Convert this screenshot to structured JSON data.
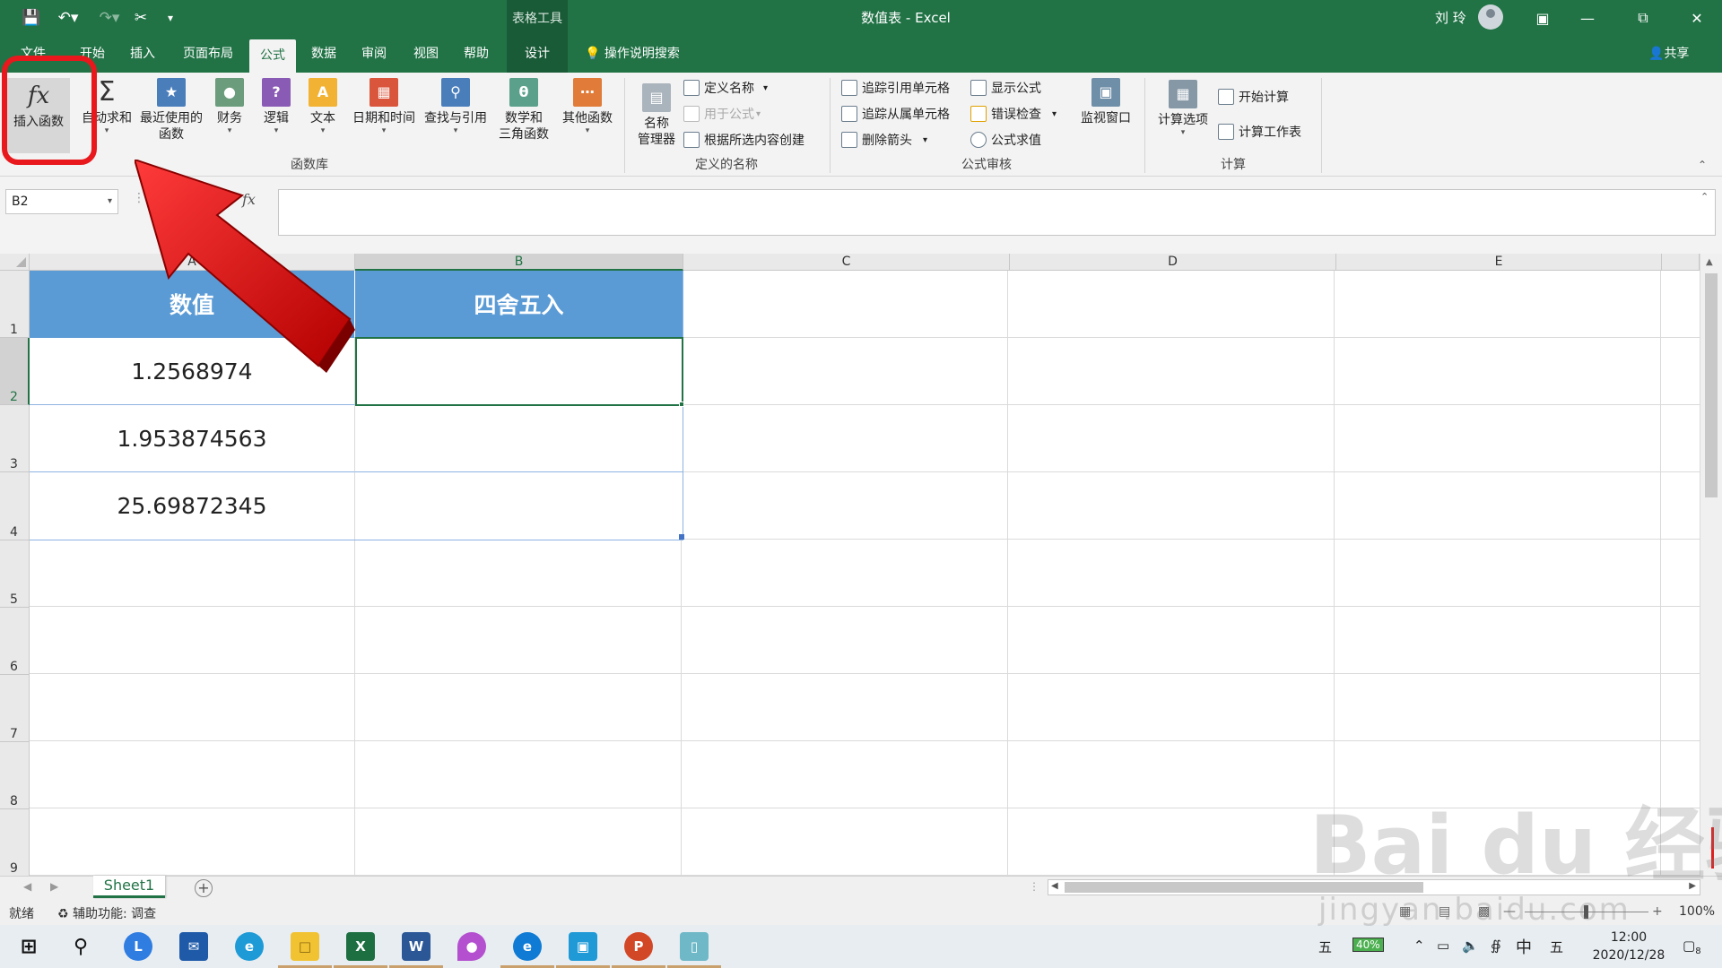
{
  "titlebar": {
    "context_label": "表格工具",
    "title": "数值表 - Excel",
    "user": "刘 玲"
  },
  "tabs": [
    {
      "label": "文件"
    },
    {
      "label": "开始"
    },
    {
      "label": "插入"
    },
    {
      "label": "页面布局"
    },
    {
      "label": "公式"
    },
    {
      "label": "数据"
    },
    {
      "label": "审阅"
    },
    {
      "label": "视图"
    },
    {
      "label": "帮助"
    },
    {
      "label": "设计"
    }
  ],
  "tell_me": "操作说明搜索",
  "share": "共享",
  "ribbon": {
    "function_library": {
      "insert_function": "插入函数",
      "autosum": "自动求和",
      "recent_1": "最近使用的",
      "recent_2": "函数",
      "financial": "财务",
      "logical": "逻辑",
      "text": "文本",
      "datetime": "日期和时间",
      "lookup": "查找与引用",
      "math_1": "数学和",
      "math_2": "三角函数",
      "more": "其他函数",
      "group": "函数库"
    },
    "defined_names": {
      "manager_1": "名称",
      "manager_2": "管理器",
      "define": "定义名称",
      "use_in": "用于公式",
      "create": "根据所选内容创建",
      "group": "定义的名称"
    },
    "auditing": {
      "trace_prec": "追踪引用单元格",
      "trace_dep": "追踪从属单元格",
      "remove_arrows": "删除箭头",
      "show_formulas": "显示公式",
      "error_check": "错误检查",
      "evaluate": "公式求值",
      "watch": "监视窗口",
      "group": "公式审核"
    },
    "calculation": {
      "options": "计算选项",
      "calc_now": "开始计算",
      "calc_sheet": "计算工作表",
      "group": "计算"
    }
  },
  "namebox": "B2",
  "fx_label": "fx",
  "columns": [
    "A",
    "B",
    "C",
    "D",
    "E"
  ],
  "rows": [
    "1",
    "2",
    "3",
    "4",
    "5",
    "6",
    "7",
    "8",
    "9"
  ],
  "table": {
    "header_a": "数值",
    "header_b": "四舍五入",
    "values": [
      "1.2568974",
      "1.953874563",
      "25.69872345"
    ]
  },
  "sheet_tab": "Sheet1",
  "status": {
    "ready": "就绪",
    "accessibility": "辅助功能: 调查",
    "zoom": "100%"
  },
  "taskbar": {
    "battery": "40%",
    "ime_cn": "中",
    "ime_wubi": "五",
    "time": "12:00",
    "date": "2020/12/28",
    "notif": "8"
  },
  "watermark": {
    "brand": "Bai du 经验",
    "url": "jingyan.baidu.com"
  },
  "colors": {
    "excel_green": "#217346",
    "header_blue": "#5b9bd5",
    "highlight_red": "#e8181d"
  }
}
